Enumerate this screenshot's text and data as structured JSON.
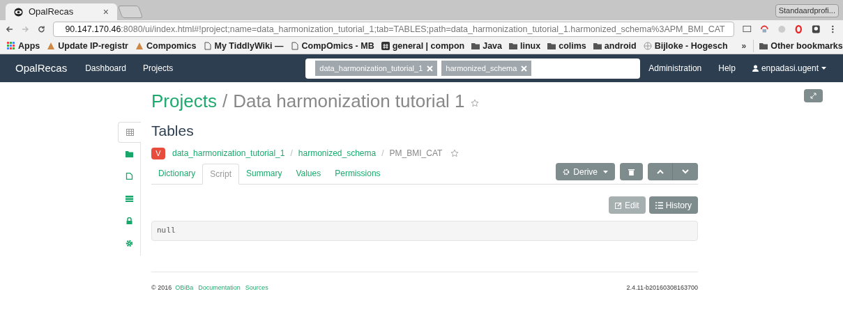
{
  "browser": {
    "tab_title": "OpalRecas",
    "tab_close": "×",
    "profile": "Standaardprofi...",
    "url_host": "90.147.170.46",
    "url_rest": ":8080/ui/index.html#!project;name=data_harmonization_tutorial_1;tab=TABLES;path=data_harmonization_tutorial_1.harmonized_schema%3APM_BMI_CAT",
    "bookmarks": [
      {
        "kind": "apps",
        "label": "Apps"
      },
      {
        "kind": "site",
        "label": "Update IP-registr"
      },
      {
        "kind": "site",
        "label": "Compomics"
      },
      {
        "kind": "page",
        "label": "My TiddlyWiki —"
      },
      {
        "kind": "page",
        "label": "CompOmics - MB"
      },
      {
        "kind": "hash",
        "label": "general | compon"
      },
      {
        "kind": "folder",
        "label": "Java"
      },
      {
        "kind": "folder",
        "label": "linux"
      },
      {
        "kind": "folder",
        "label": "colims"
      },
      {
        "kind": "folder",
        "label": "android"
      },
      {
        "kind": "globe",
        "label": "Bijloke - Hogesch"
      }
    ],
    "overflow": "»",
    "other_bookmarks": "Other bookmarks"
  },
  "navbar": {
    "brand": "OpalRecas",
    "links": [
      "Dashboard",
      "Projects"
    ],
    "search_tags": [
      "data_harmonization_tutorial_1",
      "harmonized_schema"
    ],
    "right_links": [
      "Administration",
      "Help"
    ],
    "user": "enpadasi.ugent"
  },
  "page": {
    "breadcrumb_root": "Projects",
    "separator": "/",
    "project_title": "Data harmonization tutorial 1",
    "side_nav": [
      {
        "kind": "table",
        "selected": true
      },
      {
        "kind": "folder",
        "selected": false
      },
      {
        "kind": "file",
        "selected": false
      },
      {
        "kind": "server",
        "selected": false
      },
      {
        "kind": "lock",
        "selected": false
      },
      {
        "kind": "gear",
        "selected": false
      }
    ],
    "heading": "Tables",
    "badge": "V",
    "path": [
      {
        "label": "data_harmonization_tutorial_1",
        "link": true
      },
      {
        "label": "harmonized_schema",
        "link": true
      },
      {
        "label": "PM_BMI_CAT",
        "link": false
      }
    ],
    "tabs": [
      {
        "label": "Dictionary",
        "selected": false
      },
      {
        "label": "Script",
        "selected": true
      },
      {
        "label": "Summary",
        "selected": false
      },
      {
        "label": "Values",
        "selected": false
      },
      {
        "label": "Permissions",
        "selected": false
      }
    ],
    "derive": "Derive",
    "edit": {
      "label": "Edit",
      "disabled": true
    },
    "history": "History",
    "script": "null"
  },
  "footer": {
    "copyright": "© 2016",
    "links": [
      "OBiBa",
      "Documentation",
      "Sources"
    ],
    "version": "2.4.11-b20160308163700"
  }
}
